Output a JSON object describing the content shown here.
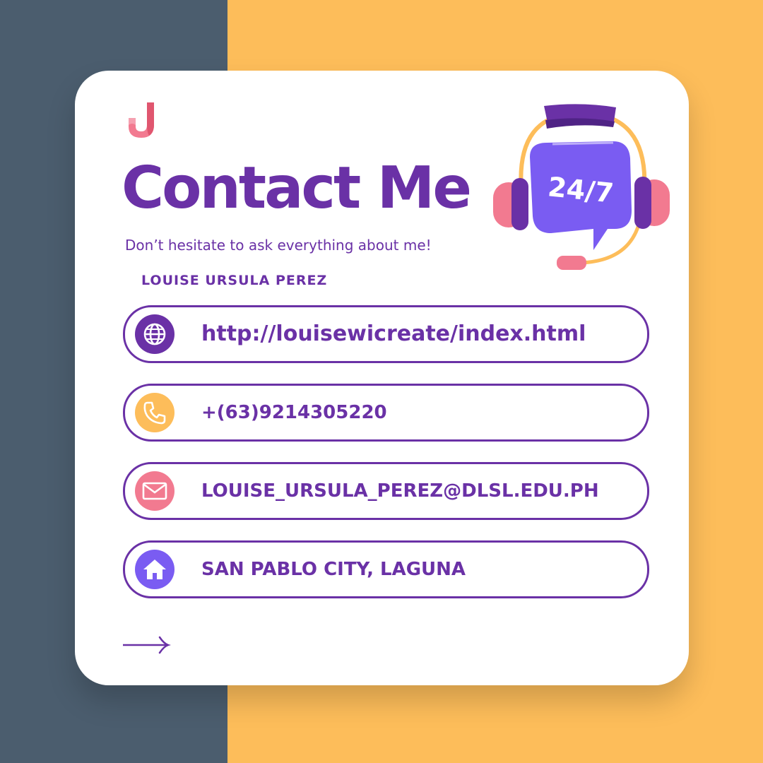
{
  "title": "Contact Me",
  "subtitle": "Don’t hesitate to ask everything about me!",
  "name": "LOUISE URSULA PEREZ",
  "badge_text": "24/7",
  "contacts": [
    {
      "icon": "globe-icon",
      "text": "http://louisewicreate/index.html",
      "color": "#6a31a6"
    },
    {
      "icon": "phone-icon",
      "text": "+(63)9214305220",
      "color": "#fdbd5a"
    },
    {
      "icon": "mail-icon",
      "text": "LOUISE_URSULA_PEREZ@DLSL.EDU.PH",
      "color": "#f27a90"
    },
    {
      "icon": "home-icon",
      "text": "SAN PABLO CITY, LAGUNA",
      "color": "#7a5cf2"
    }
  ],
  "colors": {
    "primary": "#6a31a6",
    "background_left": "#4b5d6e",
    "background_right": "#fdbd5a",
    "pink": "#f27a90",
    "violet": "#7a5cf2"
  },
  "icons": {
    "logo": "brand-logo-icon",
    "illustration": "headset-24-7-icon",
    "next": "arrow-right-icon"
  }
}
